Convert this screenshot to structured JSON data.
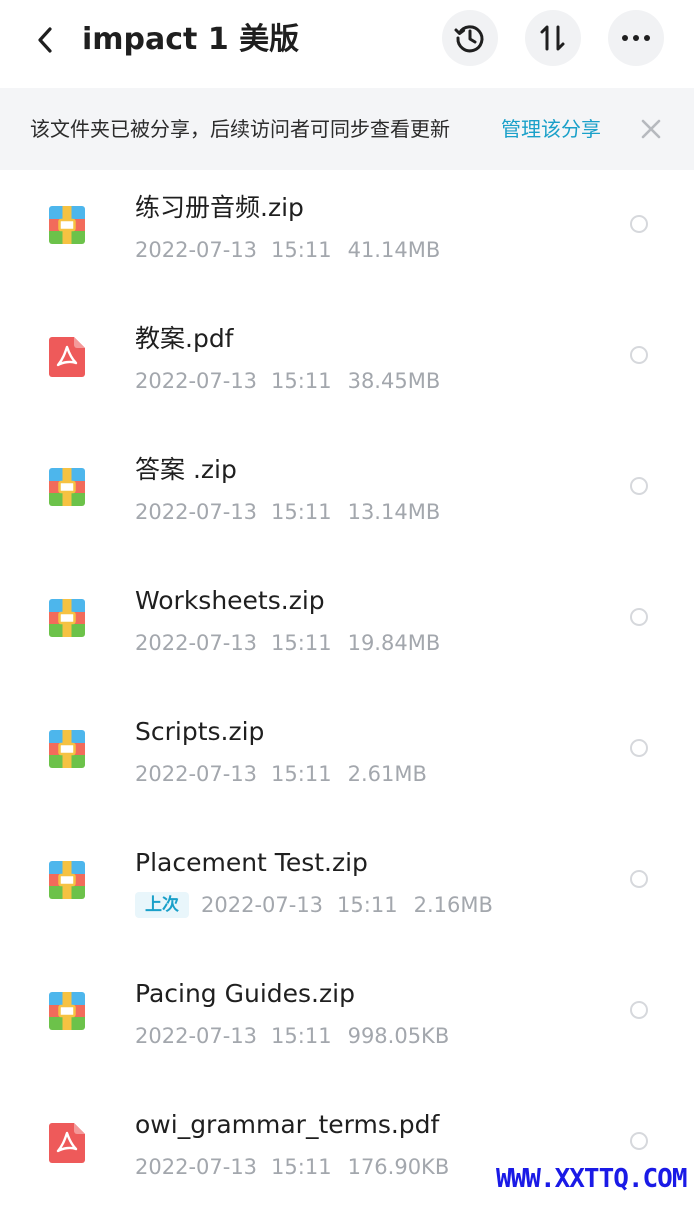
{
  "header": {
    "title": "impact 1 美版",
    "back_icon": "chevron-left-icon",
    "history_icon": "history-icon",
    "sort_icon": "sort-icon",
    "more_icon": "more-horizontal-icon"
  },
  "banner": {
    "text": "该文件夹已被分享，后续访问者可同步查看更新",
    "link": "管理该分享",
    "close_icon": "close-icon"
  },
  "files": [
    {
      "name": "练习册音频.zip",
      "type": "zip",
      "date": "2022-07-13",
      "time": "15:11",
      "size": "41.14MB"
    },
    {
      "name": "教案.pdf",
      "type": "pdf",
      "date": "2022-07-13",
      "time": "15:11",
      "size": "38.45MB"
    },
    {
      "name": "答案 .zip",
      "type": "zip",
      "date": "2022-07-13",
      "time": "15:11",
      "size": "13.14MB"
    },
    {
      "name": "Worksheets.zip",
      "type": "zip",
      "date": "2022-07-13",
      "time": "15:11",
      "size": "19.84MB"
    },
    {
      "name": "Scripts.zip",
      "type": "zip",
      "date": "2022-07-13",
      "time": "15:11",
      "size": "2.61MB"
    },
    {
      "name": "Placement Test.zip",
      "type": "zip",
      "badge": "上次",
      "date": "2022-07-13",
      "time": "15:11",
      "size": "2.16MB"
    },
    {
      "name": "Pacing Guides.zip",
      "type": "zip",
      "date": "2022-07-13",
      "time": "15:11",
      "size": "998.05KB"
    },
    {
      "name": "owi_grammar_terms.pdf",
      "type": "pdf",
      "date": "2022-07-13",
      "time": "15:11",
      "size": "176.90KB"
    }
  ],
  "watermark": "WWW.XXTTQ.COM",
  "colors": {
    "accent": "#1aa0c9",
    "pdf_red": "#ee5a5a",
    "zip_blue": "#4db6ec",
    "zip_red": "#f26b5b",
    "zip_green": "#6cc24a",
    "zip_gold": "#f6c242"
  }
}
